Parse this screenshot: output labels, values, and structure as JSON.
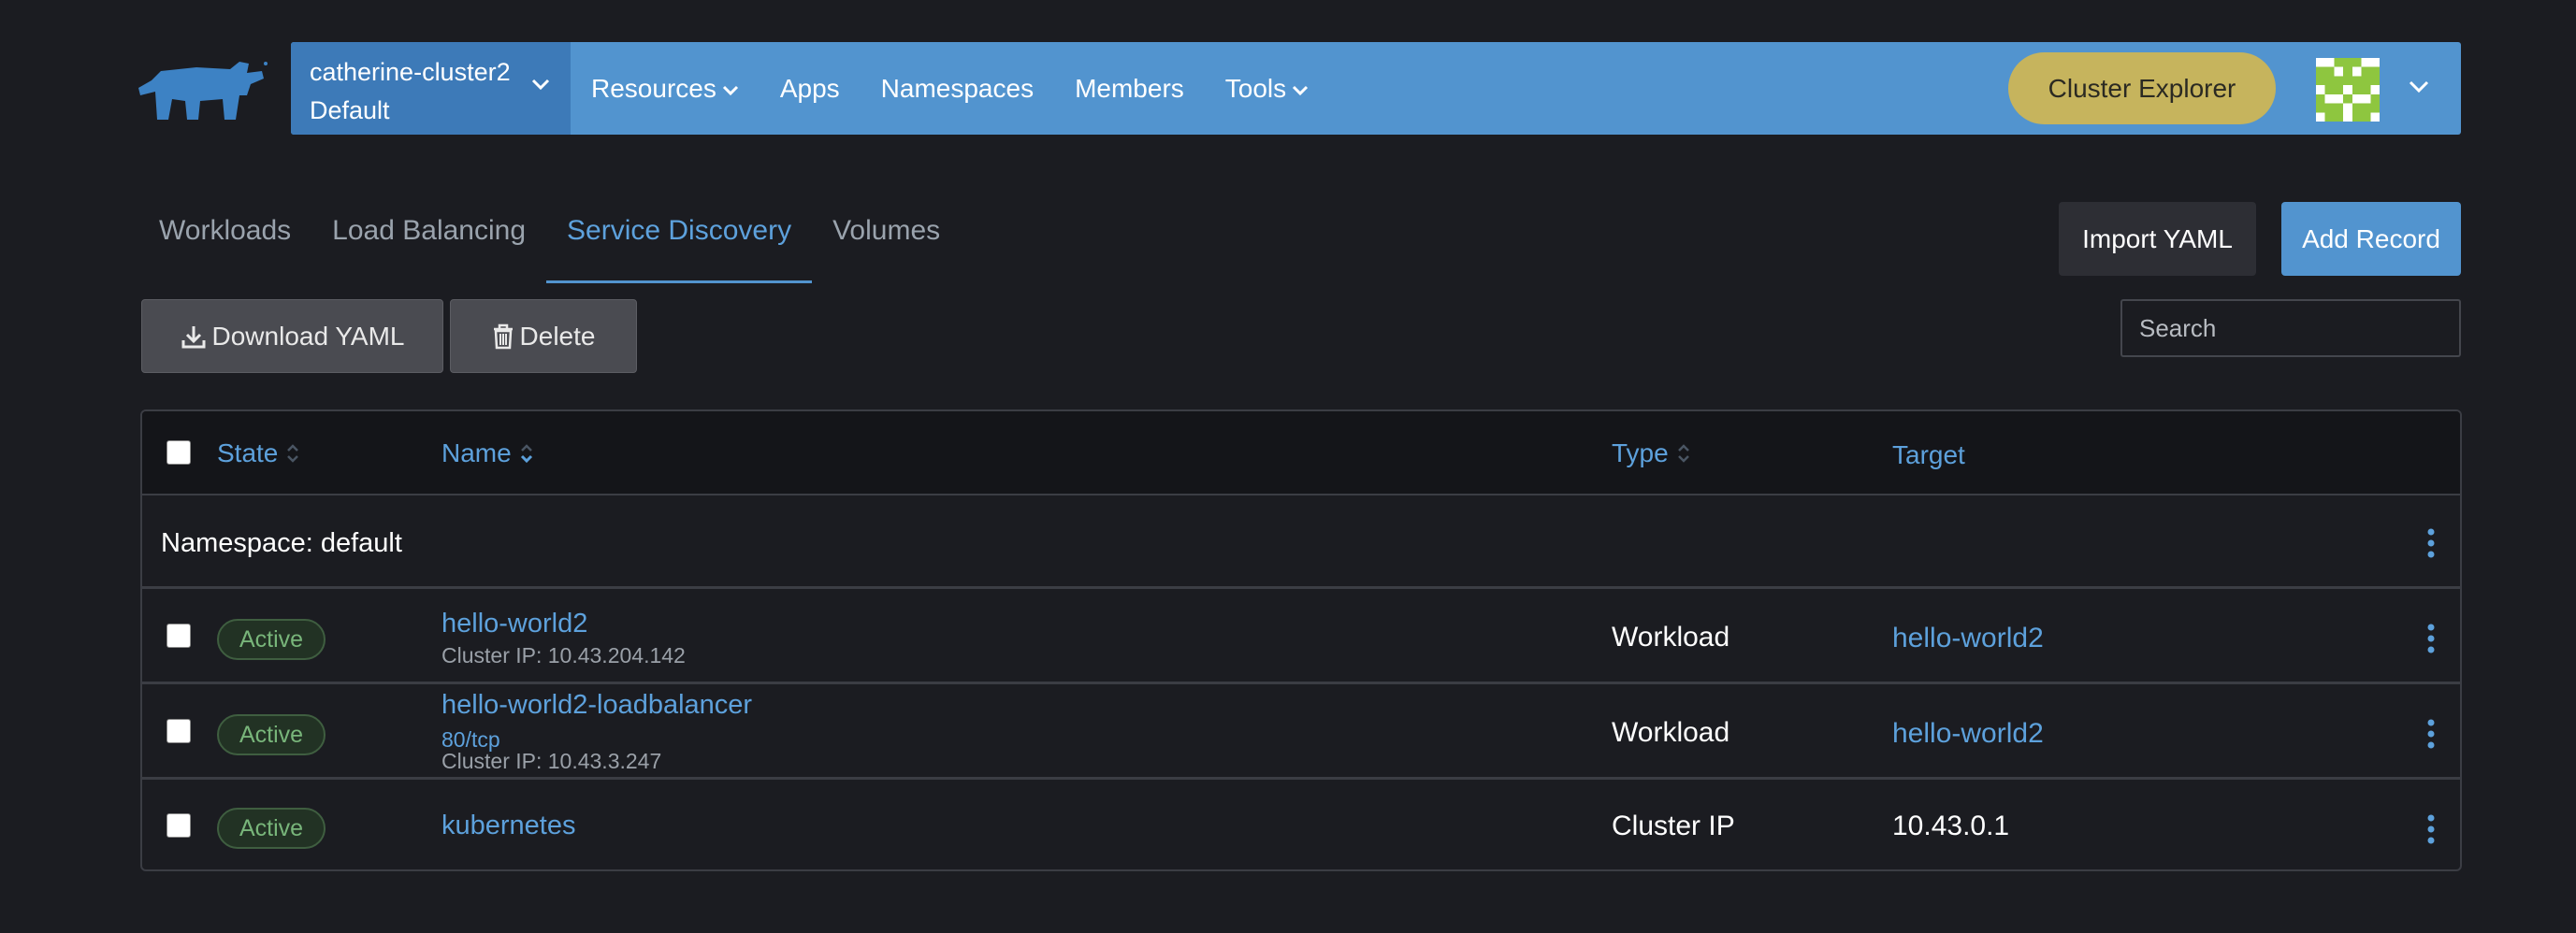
{
  "header": {
    "logo_icon": "rancher-cow-logo",
    "cluster_name": "catherine-cluster2",
    "project_name": "Default",
    "nav": [
      {
        "label": "Resources",
        "has_dropdown": true
      },
      {
        "label": "Apps",
        "has_dropdown": false
      },
      {
        "label": "Namespaces",
        "has_dropdown": false
      },
      {
        "label": "Members",
        "has_dropdown": false
      },
      {
        "label": "Tools",
        "has_dropdown": true
      }
    ],
    "cluster_explorer_label": "Cluster Explorer",
    "avatar_icon": "user-avatar-identicon"
  },
  "tabs": [
    {
      "label": "Workloads",
      "active": false
    },
    {
      "label": "Load Balancing",
      "active": false
    },
    {
      "label": "Service Discovery",
      "active": true
    },
    {
      "label": "Volumes",
      "active": false
    }
  ],
  "actions": {
    "import_yaml_label": "Import YAML",
    "add_record_label": "Add Record",
    "download_yaml_label": "Download YAML",
    "delete_label": "Delete",
    "search_placeholder": "Search"
  },
  "table": {
    "columns": {
      "state": "State",
      "name": "Name",
      "type": "Type",
      "target": "Target"
    },
    "group_label": "Namespace: default",
    "rows": [
      {
        "state": "Active",
        "name": "hello-world2",
        "port": "",
        "cluster_ip": "Cluster IP: 10.43.204.142",
        "type": "Workload",
        "target": "hello-world2",
        "target_is_link": true
      },
      {
        "state": "Active",
        "name": "hello-world2-loadbalancer",
        "port": "80/tcp",
        "cluster_ip": "Cluster IP: 10.43.3.247",
        "type": "Workload",
        "target": "hello-world2",
        "target_is_link": true
      },
      {
        "state": "Active",
        "name": "kubernetes",
        "port": "",
        "cluster_ip": "",
        "type": "Cluster IP",
        "target": "10.43.0.1",
        "target_is_link": false
      }
    ]
  },
  "colors": {
    "background": "#1b1c21",
    "header_blue": "#5294cf",
    "switcher_blue": "#3d7ab8",
    "link_blue": "#5da1dc",
    "explorer_gold": "#c6b45d",
    "active_green": "#78b57a",
    "avatar_green": "#8ec63f"
  }
}
